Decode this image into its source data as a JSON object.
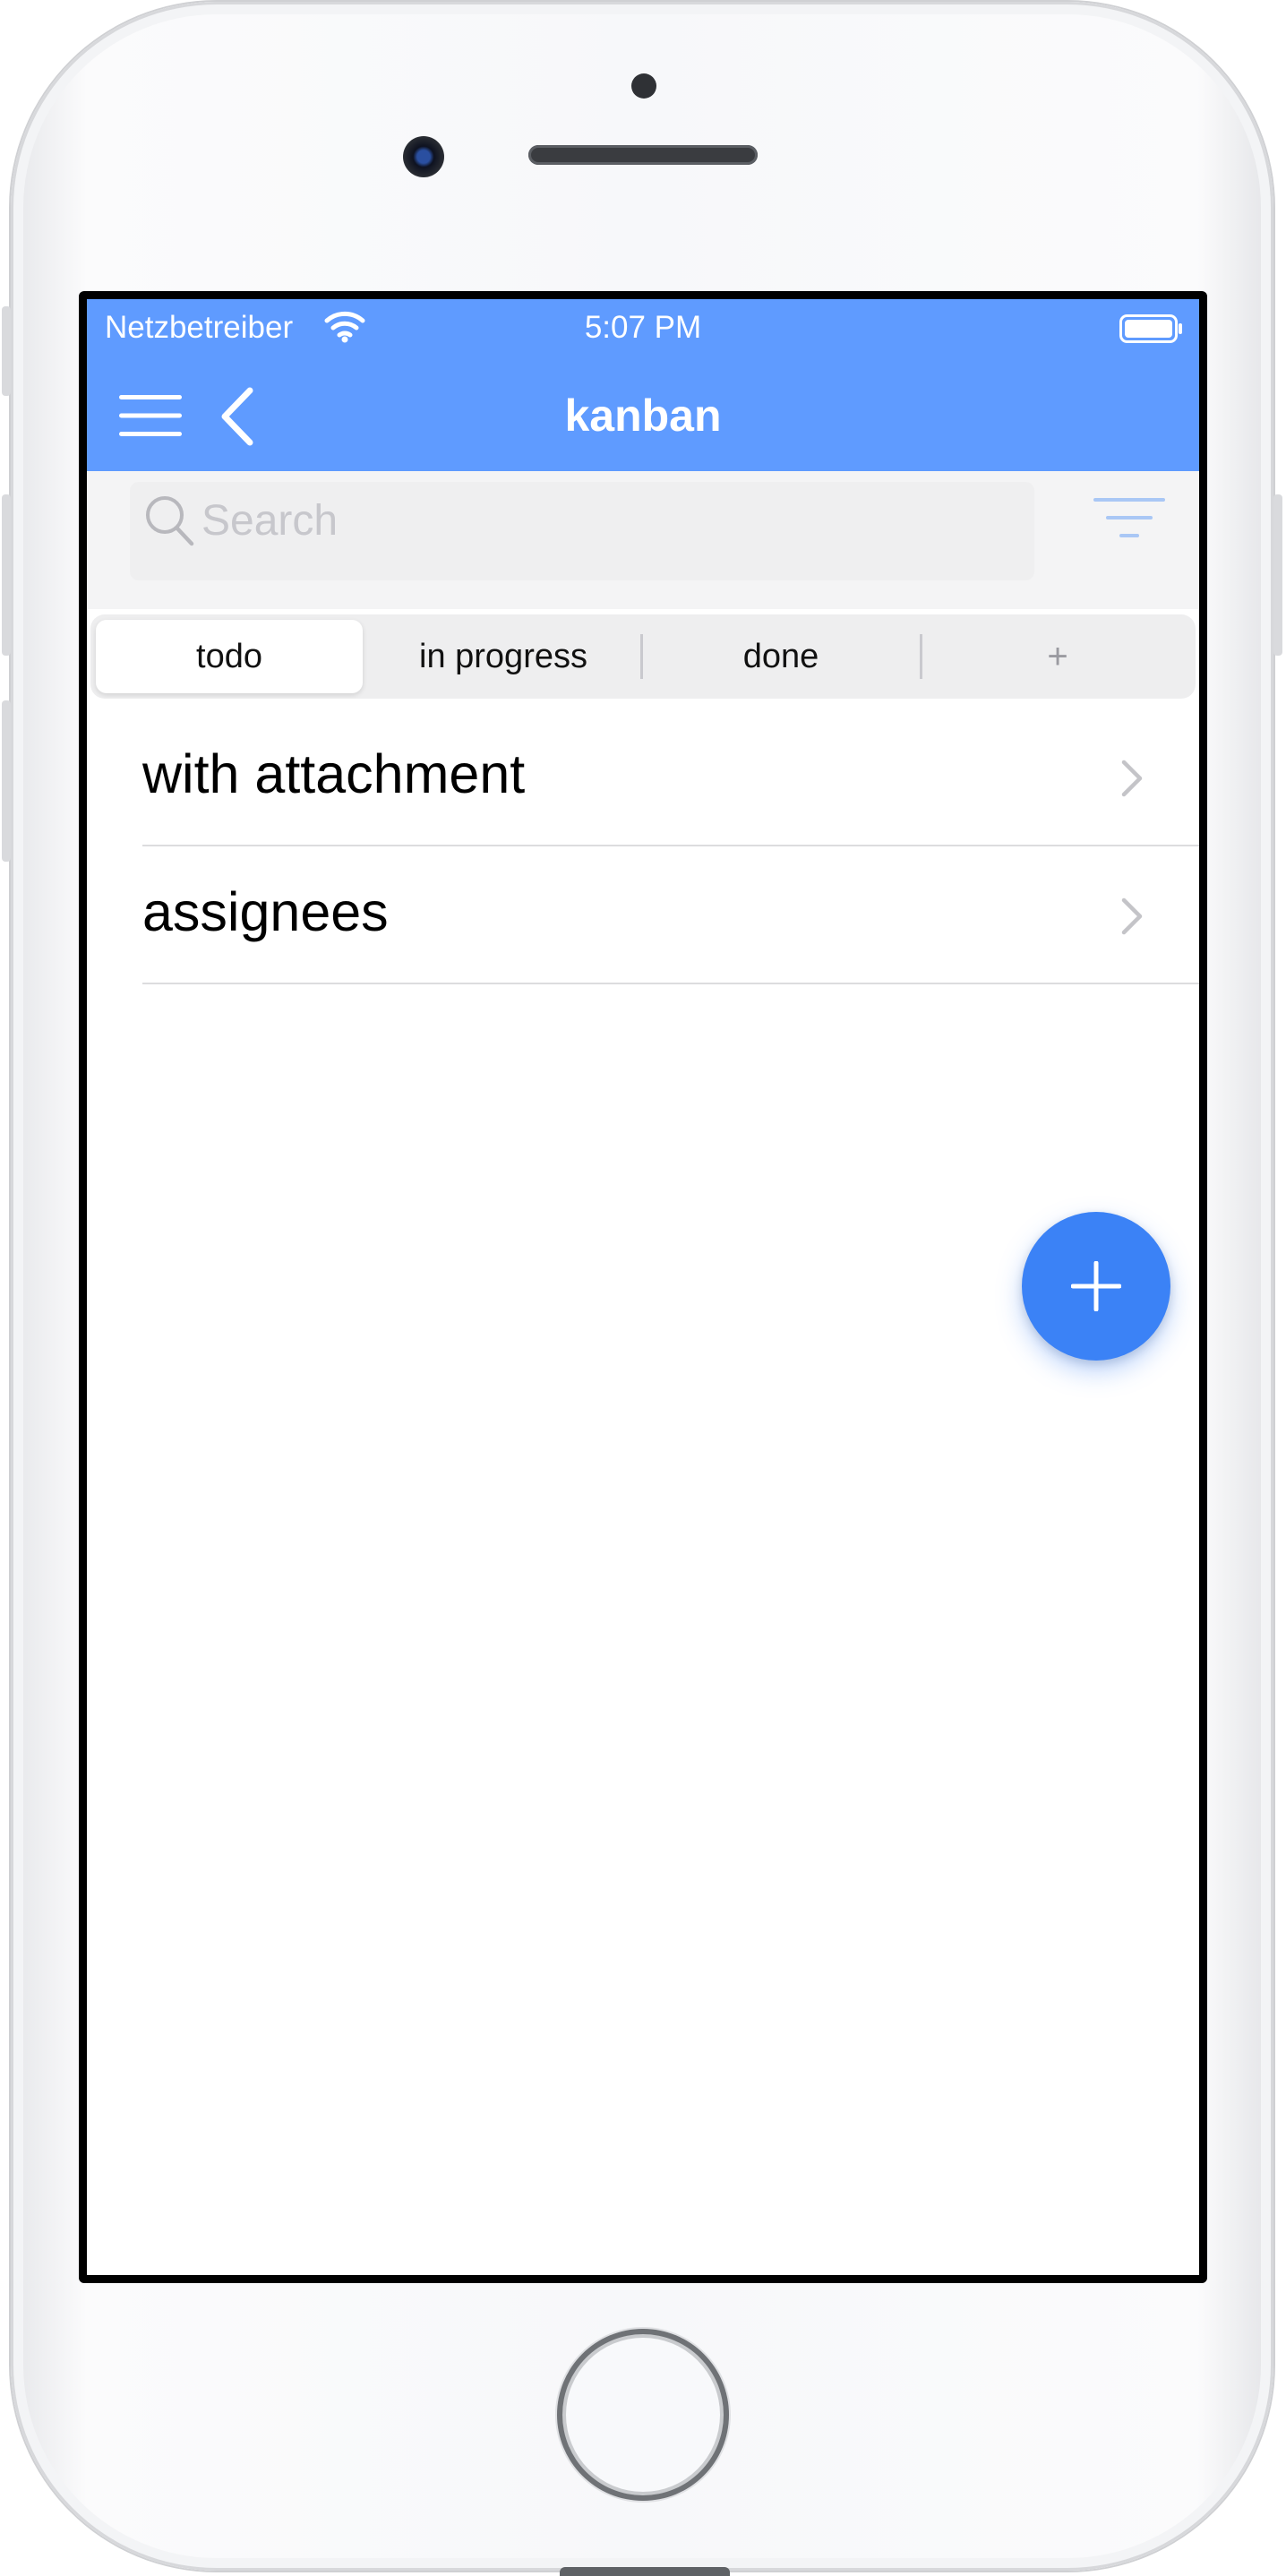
{
  "status_bar": {
    "carrier": "Netzbetreiber",
    "time": "5:07 PM",
    "icons": [
      "wifi-icon",
      "battery-icon"
    ]
  },
  "nav_bar": {
    "title": "kanban",
    "icons": [
      "menu-icon",
      "back-icon"
    ]
  },
  "search": {
    "placeholder": "Search",
    "value": "",
    "icons": [
      "search-icon",
      "filter-icon"
    ]
  },
  "segments": {
    "items": [
      {
        "label": "todo",
        "selected": true
      },
      {
        "label": "in progress",
        "selected": false
      },
      {
        "label": "done",
        "selected": false
      },
      {
        "label": "+",
        "selected": false
      }
    ]
  },
  "list": {
    "items": [
      {
        "label": "with attachment"
      },
      {
        "label": "assignees"
      }
    ]
  },
  "fab": {
    "icon": "plus-icon"
  },
  "colors": {
    "header": "#5f9bff",
    "fab": "#3b82f6",
    "search_background": "#f4f4f5"
  }
}
